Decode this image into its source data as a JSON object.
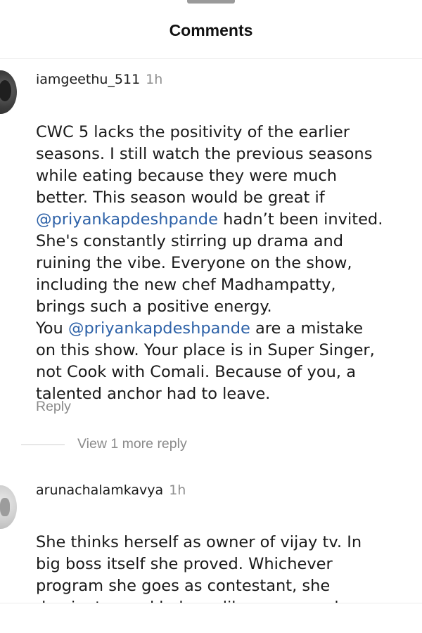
{
  "header": {
    "title": "Comments"
  },
  "comments": [
    {
      "username": "iamgeethu_511",
      "time": "1h",
      "body": [
        {
          "text": "CWC 5 lacks the positivity of the earlier\nseasons. I still watch the previous seasons\nwhile eating because they were much\nbetter. This season would be great if\n"
        },
        {
          "mention": "@priyankapdeshpande"
        },
        {
          "text": " hadn’t been invited.\nShe's constantly stirring up drama and\nruining the vibe. Everyone on the show,\nincluding the new chef Madhampatty,\nbrings such a positive energy.\nYou "
        },
        {
          "mention": "@priyankapdeshpande"
        },
        {
          "text": " are a mistake\non this show. Your place is in Super Singer,\nnot Cook with Comali. Because of you, a\ntalented anchor had to leave."
        }
      ],
      "reply_label": "Reply",
      "view_replies_label": "View 1 more reply"
    },
    {
      "username": "arunachalamkavya",
      "time": "1h",
      "body": [
        {
          "text": "She thinks herself as owner of vijay tv. In\nbig boss itself she proved. Whichever\nprogram she goes as contestant, she\ndominates and behave like owner and"
        }
      ]
    }
  ],
  "icons": {
    "avatar_1": "user-avatar-icon",
    "avatar_2": "user-avatar-icon"
  },
  "colors": {
    "mention": "#2e62a8",
    "muted": "#8e8e8e",
    "text": "#1a1a1a"
  }
}
